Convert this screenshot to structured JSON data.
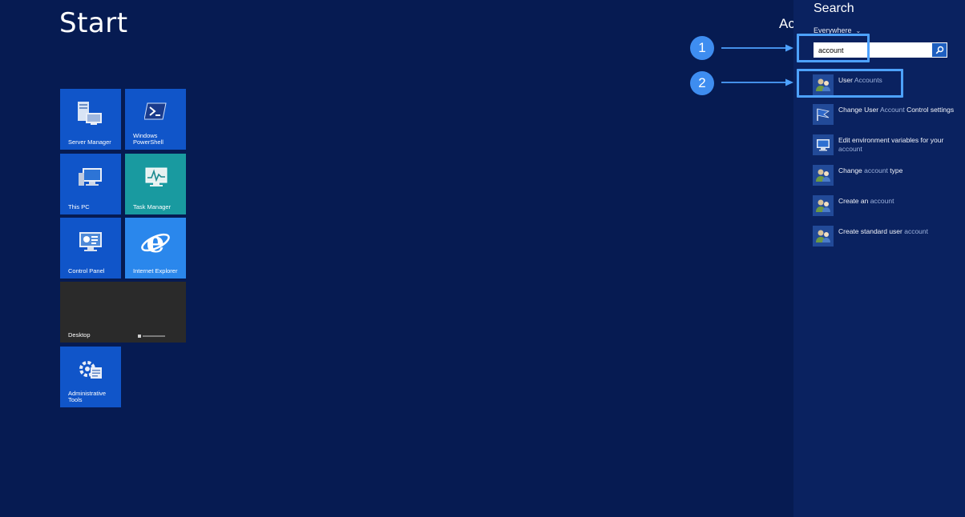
{
  "start": {
    "title": "Start",
    "user_name_partial": "Ac"
  },
  "tiles": [
    {
      "label": "Server Manager",
      "icon": "server-manager-icon"
    },
    {
      "label": "Windows PowerShell",
      "icon": "powershell-icon"
    },
    {
      "label": "This PC",
      "icon": "this-pc-icon"
    },
    {
      "label": "Task Manager",
      "icon": "task-manager-icon"
    },
    {
      "label": "Control Panel",
      "icon": "control-panel-icon"
    },
    {
      "label": "Internet Explorer",
      "icon": "internet-explorer-icon"
    },
    {
      "label": "Desktop",
      "icon": "desktop-icon"
    },
    {
      "label": "Administrative Tools",
      "icon": "administrative-tools-icon"
    }
  ],
  "search": {
    "title": "Search",
    "scope": "Everywhere",
    "query": "account",
    "results": [
      {
        "pre": "User ",
        "match": "Accounts",
        "post": "",
        "icon": "user-accounts-icon"
      },
      {
        "pre": "Change User ",
        "match": "Account",
        "post": " Control settings",
        "icon": "uac-flag-icon"
      },
      {
        "pre": "Edit environment variables for your ",
        "match": "account",
        "post": "",
        "icon": "system-properties-icon"
      },
      {
        "pre": "Change ",
        "match": "account",
        "post": " type",
        "icon": "user-accounts-icon"
      },
      {
        "pre": "Create an ",
        "match": "account",
        "post": "",
        "icon": "user-accounts-icon"
      },
      {
        "pre": "Create standard user ",
        "match": "account",
        "post": "",
        "icon": "user-accounts-icon"
      }
    ]
  },
  "annotations": {
    "step1": "1",
    "step2": "2"
  },
  "colors": {
    "background": "#061b52",
    "search_pane": "#0a2260",
    "tile_blue": "#1055c9",
    "tile_teal": "#199aa0",
    "tile_ie": "#2a87ec",
    "tile_desktop": "#2a2a2a",
    "highlight_text": "#9db2dc",
    "callout": "#4da2ff"
  }
}
